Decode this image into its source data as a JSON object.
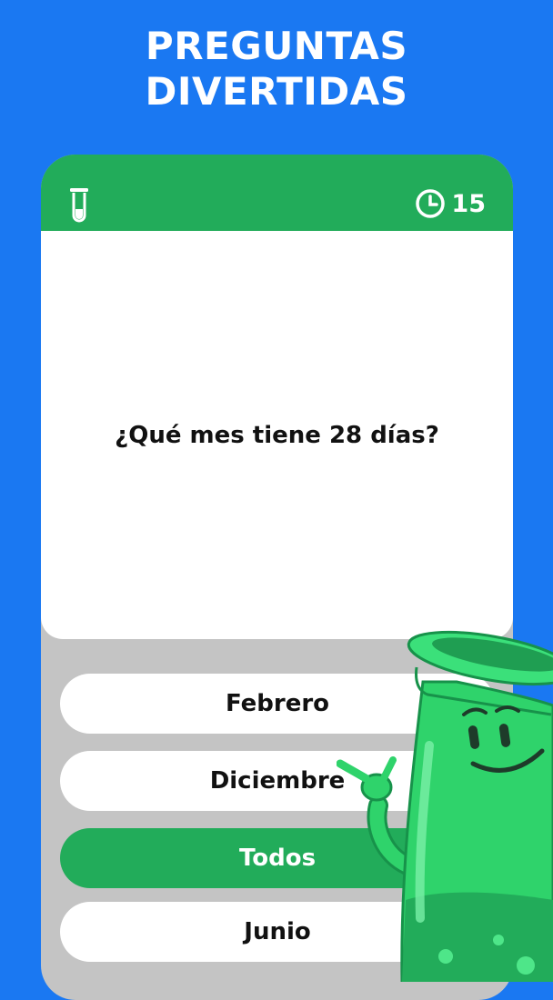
{
  "headline": {
    "line1": "PREGUNTAS",
    "line2": "DIVERTIDAS"
  },
  "quiz": {
    "category_icon": "flask-icon",
    "timer_icon": "clock-icon",
    "timer_value": "15",
    "question": "¿Qué mes tiene 28 días?",
    "answers": [
      {
        "label": "Febrero",
        "state": "default"
      },
      {
        "label": "Diciembre",
        "state": "default"
      },
      {
        "label": "Todos",
        "state": "correct"
      },
      {
        "label": "Junio",
        "state": "default"
      }
    ]
  },
  "colors": {
    "background": "#1a78f2",
    "header": "#22ac5a",
    "correct": "#22ac5a",
    "mascot": "#2fd36b"
  }
}
